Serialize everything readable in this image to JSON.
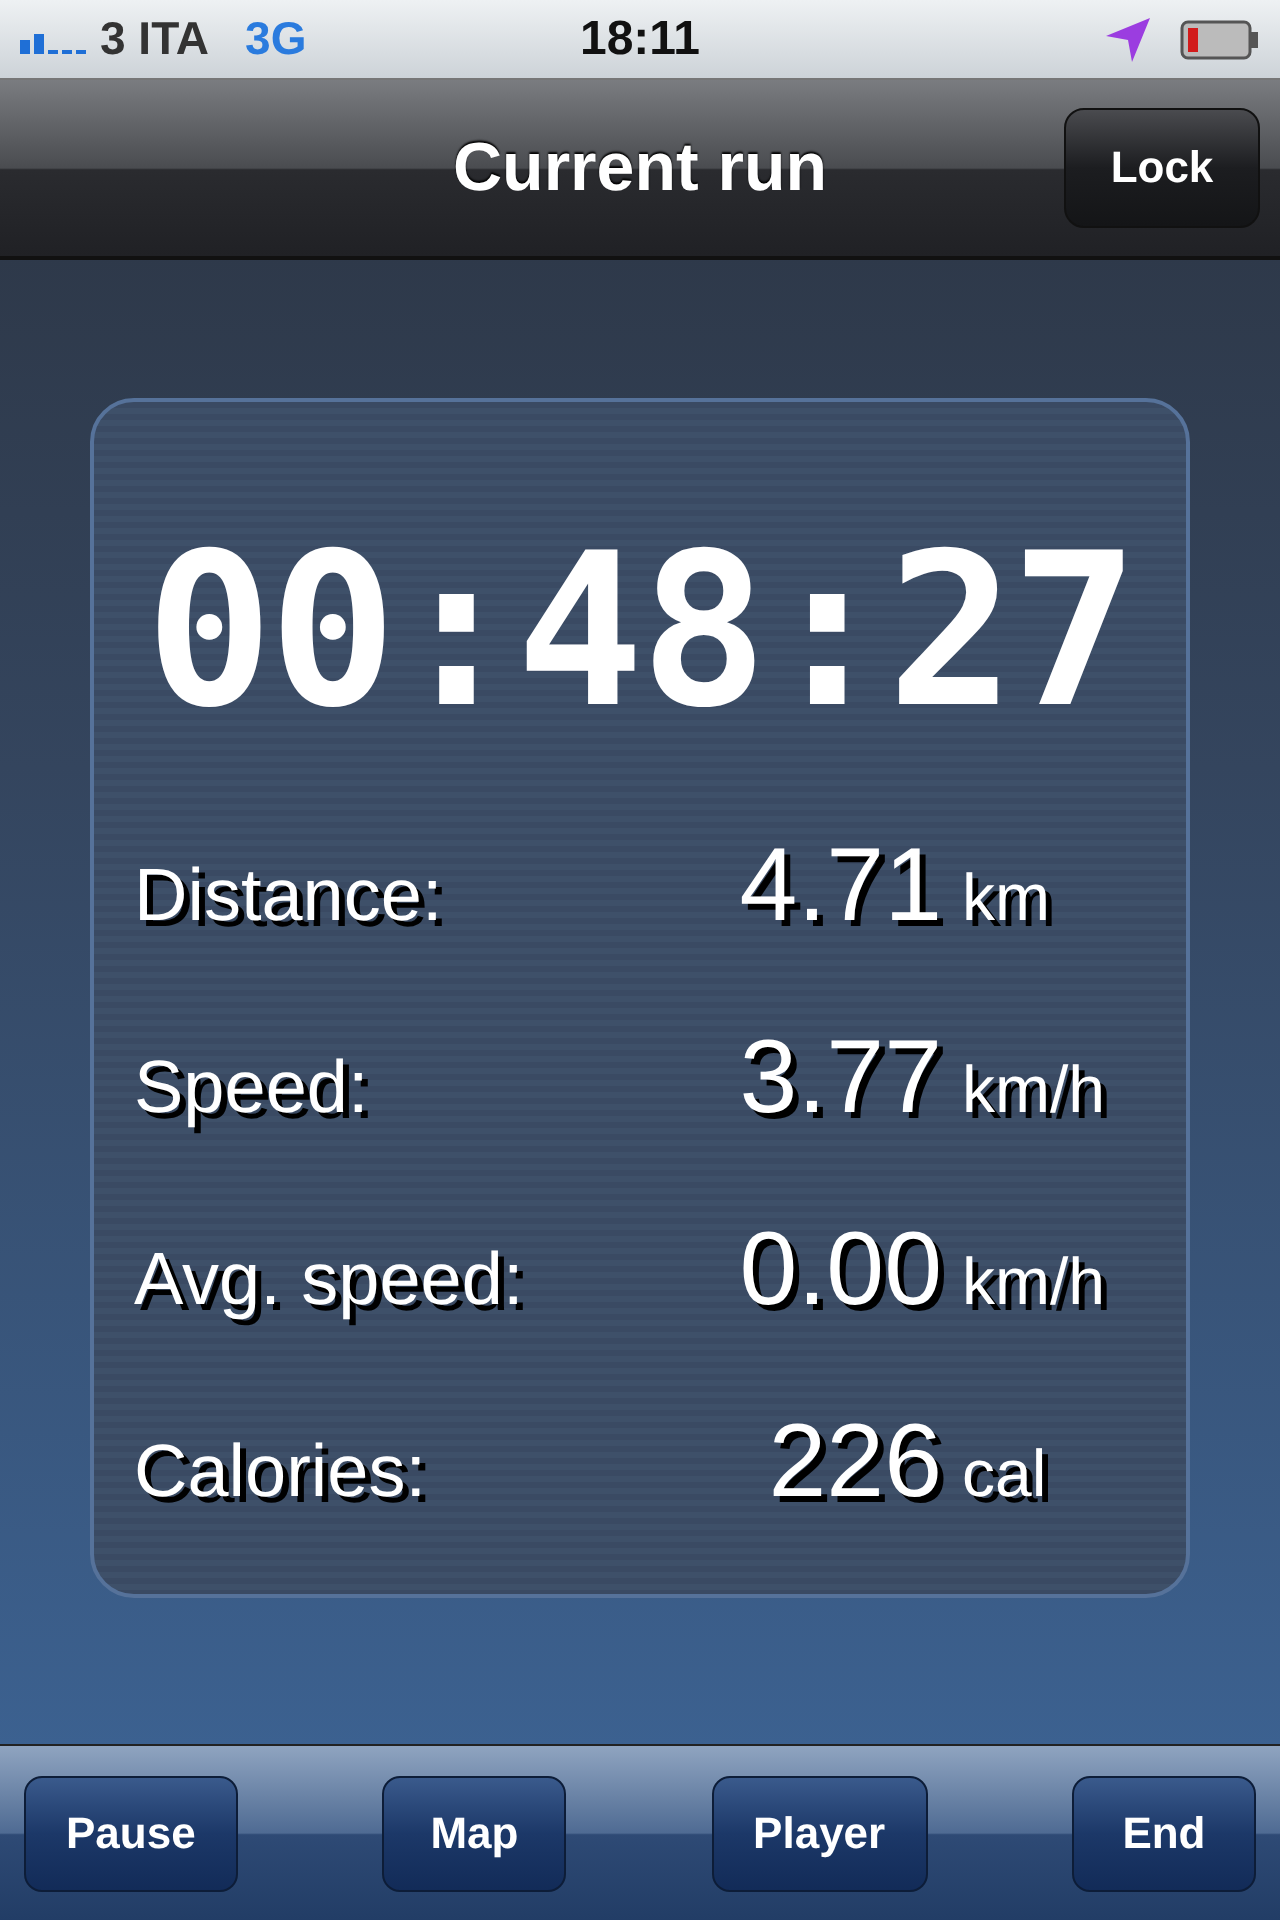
{
  "status_bar": {
    "carrier": "3 ITA",
    "network": "3G",
    "time": "18:11"
  },
  "nav": {
    "title": "Current run",
    "button": "Lock"
  },
  "timer": "00:48:27",
  "stats": [
    {
      "label": "Distance:",
      "value": "4.71",
      "unit": "km"
    },
    {
      "label": "Speed:",
      "value": "3.77",
      "unit": "km/h"
    },
    {
      "label": "Avg. speed:",
      "value": "0.00",
      "unit": "km/h"
    },
    {
      "label": "Calories:",
      "value": "226",
      "unit": "cal"
    }
  ],
  "toolbar": [
    "Pause",
    "Map",
    "Player",
    "End"
  ]
}
